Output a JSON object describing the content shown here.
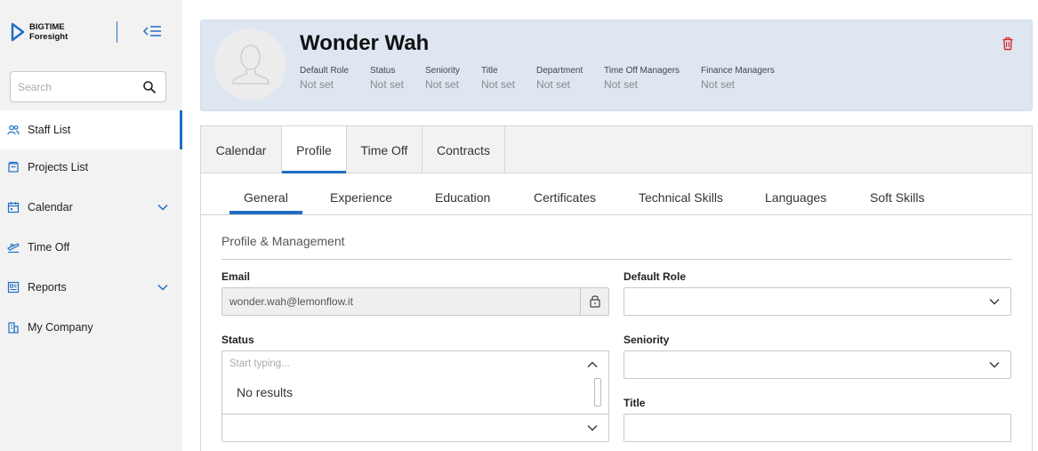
{
  "brand": {
    "line1": "BIGTIME",
    "line2": "Foresight"
  },
  "search": {
    "placeholder": "Search"
  },
  "sidebar": {
    "items": [
      {
        "label": "Staff List",
        "icon": "people-icon",
        "active": true
      },
      {
        "label": "Projects List",
        "icon": "folder-icon"
      },
      {
        "label": "Calendar",
        "icon": "calendar-icon",
        "expandable": true
      },
      {
        "label": "Time Off",
        "icon": "plane-icon"
      },
      {
        "label": "Reports",
        "icon": "report-icon",
        "expandable": true
      },
      {
        "label": "My Company",
        "icon": "building-icon"
      }
    ]
  },
  "profile": {
    "name": "Wonder Wah",
    "meta": [
      {
        "label": "Default Role",
        "value": "Not set"
      },
      {
        "label": "Status",
        "value": "Not set"
      },
      {
        "label": "Seniority",
        "value": "Not set"
      },
      {
        "label": "Title",
        "value": "Not set"
      },
      {
        "label": "Department",
        "value": "Not set"
      },
      {
        "label": "Time Off Managers",
        "value": "Not set"
      },
      {
        "label": "Finance Managers",
        "value": "Not set"
      }
    ]
  },
  "main_tabs": [
    {
      "label": "Calendar"
    },
    {
      "label": "Profile",
      "active": true
    },
    {
      "label": "Time Off"
    },
    {
      "label": "Contracts"
    }
  ],
  "sub_tabs": [
    {
      "label": "General",
      "active": true
    },
    {
      "label": "Experience"
    },
    {
      "label": "Education"
    },
    {
      "label": "Certificates"
    },
    {
      "label": "Technical Skills"
    },
    {
      "label": "Languages"
    },
    {
      "label": "Soft Skills"
    }
  ],
  "form": {
    "section_title": "Profile & Management",
    "email": {
      "label": "Email",
      "value": "wonder.wah@lemonflow.it"
    },
    "default_role": {
      "label": "Default Role",
      "value": ""
    },
    "status": {
      "label": "Status",
      "placeholder": "Start typing...",
      "no_results": "No results"
    },
    "seniority": {
      "label": "Seniority",
      "value": ""
    },
    "title": {
      "label": "Title",
      "value": ""
    }
  },
  "colors": {
    "accent": "#1f6fc5",
    "header_bg": "#dee6f2",
    "danger": "#d9282f"
  }
}
